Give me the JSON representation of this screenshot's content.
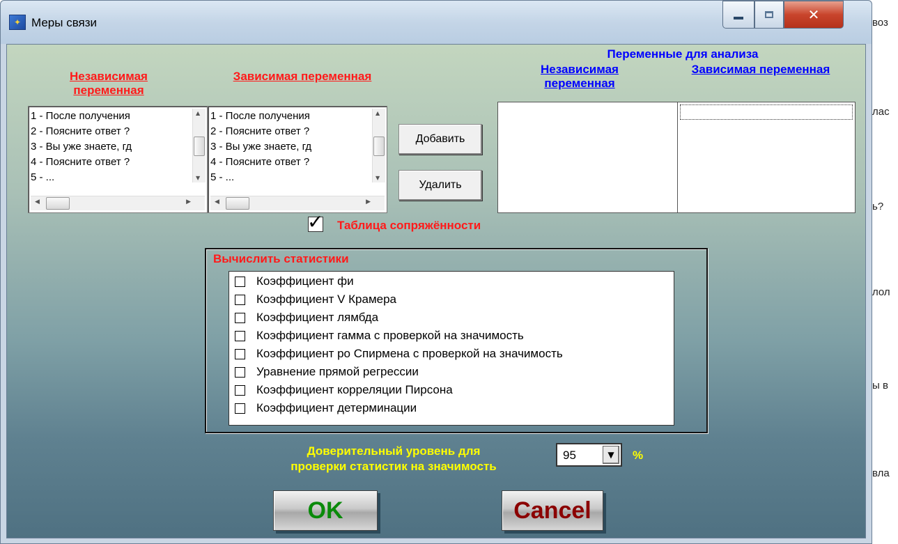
{
  "window": {
    "title": "Меры связи",
    "icon": "app-icon"
  },
  "background_fragments": [
    "воз",
    "лас",
    "ь?",
    "лол",
    "ы в",
    "вла"
  ],
  "left_lists": {
    "independent_label": "Независимая переменная",
    "dependent_label": "Зависимая переменная",
    "items": [
      "1 -  После получения",
      "2 -  Поясните ответ ?",
      "3 -  Вы уже знаете, гд",
      "4 -  Поясните ответ ?",
      "5 -  ..."
    ]
  },
  "buttons": {
    "add": "Добавить",
    "remove": "Удалить",
    "ok": "OK",
    "cancel": "Cancel"
  },
  "analysis": {
    "title": "Переменные для анализа",
    "independent_label": "Независимая переменная",
    "dependent_label": "Зависимая переменная"
  },
  "contingency": {
    "label": "Таблица сопряжённости",
    "checked": true
  },
  "statistics": {
    "group_title": "Вычислить статистики",
    "items": [
      "Коэффициент фи",
      "Коэффициент V Крамера",
      "Коэффициент лямбда",
      "Коэффициент гамма с проверкой на значимость",
      "Коэффициент ро Спирмена с проверкой на значимость",
      "Уравнение прямой регрессии",
      "Коэффициент корреляции Пирсона",
      "Коэффициент детерминации"
    ]
  },
  "confidence": {
    "label_line1": "Доверительный уровень для",
    "label_line2": "проверки статистик на значимость",
    "value": "95",
    "unit": "%"
  },
  "colors": {
    "red_label": "#ff1a1a",
    "blue_label": "#0000ff",
    "yellow_label": "#ffff00",
    "ok_text": "#0a8a0a",
    "cancel_text": "#8b0000"
  }
}
